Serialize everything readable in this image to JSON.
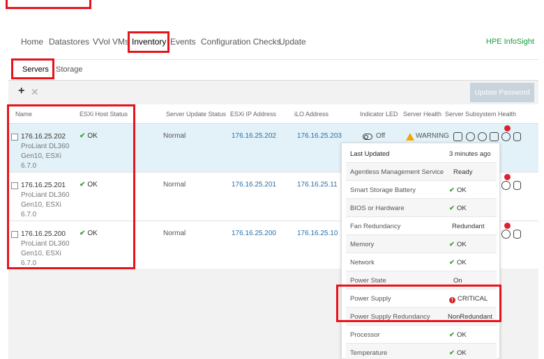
{
  "nav": {
    "items": [
      "Home",
      "Datastores",
      "VVol VMs",
      "Inventory",
      "Events",
      "Configuration Checks",
      "Update"
    ],
    "right_link": "HPE InfoSight"
  },
  "subtabs": [
    "Servers",
    "Storage"
  ],
  "toolbar": {
    "add_icon": "plus-icon",
    "remove_icon": "x-icon",
    "update_password": "Update Password"
  },
  "table": {
    "columns": [
      "Name",
      "ESXi Host Status",
      "Server Update Status",
      "ESXi IP Address",
      "iLO Address",
      "Indicator LED",
      "Server Health",
      "Server Subsystem Health"
    ],
    "rows": [
      {
        "name": "176.16.25.202",
        "model": "ProLiant DL360",
        "model2": "Gen10, ESXi",
        "model3": "6.7.0",
        "host_status": "OK",
        "update_status": "Normal",
        "esxi_ip": "176.16.25.202",
        "ilo": "176.16.25.203",
        "led": "Off",
        "health": "WARNING"
      },
      {
        "name": "176.16.25.201",
        "model": "ProLiant DL360",
        "model2": "Gen10, ESXi",
        "model3": "6.7.0",
        "host_status": "OK",
        "update_status": "Normal",
        "esxi_ip": "176.16.25.201",
        "ilo": "176.16.25.11"
      },
      {
        "name": "176.16.25.200",
        "model": "ProLiant DL360",
        "model2": "Gen10, ESXi",
        "model3": "6.7.0",
        "host_status": "OK",
        "update_status": "Normal",
        "esxi_ip": "176.16.25.200",
        "ilo": "176.16.25.10"
      }
    ]
  },
  "popup": {
    "rows": [
      {
        "label": "Last Updated",
        "value": "3 minutes ago"
      },
      {
        "label": "Agentless Management Service",
        "value": "Ready"
      },
      {
        "label": "Smart Storage Battery",
        "value": "OK"
      },
      {
        "label": "BIOS or Hardware",
        "value": "OK"
      },
      {
        "label": "Fan Redundancy",
        "value": "Redundant"
      },
      {
        "label": "Memory",
        "value": "OK"
      },
      {
        "label": "Network",
        "value": "OK"
      },
      {
        "label": "Power State",
        "value": "On"
      },
      {
        "label": "Power Supply",
        "value": "CRITICAL"
      },
      {
        "label": "Power Supply Redundancy",
        "value": "NonRedundant"
      },
      {
        "label": "Processor",
        "value": "OK"
      },
      {
        "label": "Temperature",
        "value": "OK"
      }
    ]
  },
  "colors": {
    "highlight": "#e8121b",
    "ok": "#3aa33a",
    "link": "#2a6fa8",
    "critical": "#d9232e",
    "warning": "#f0a800"
  }
}
